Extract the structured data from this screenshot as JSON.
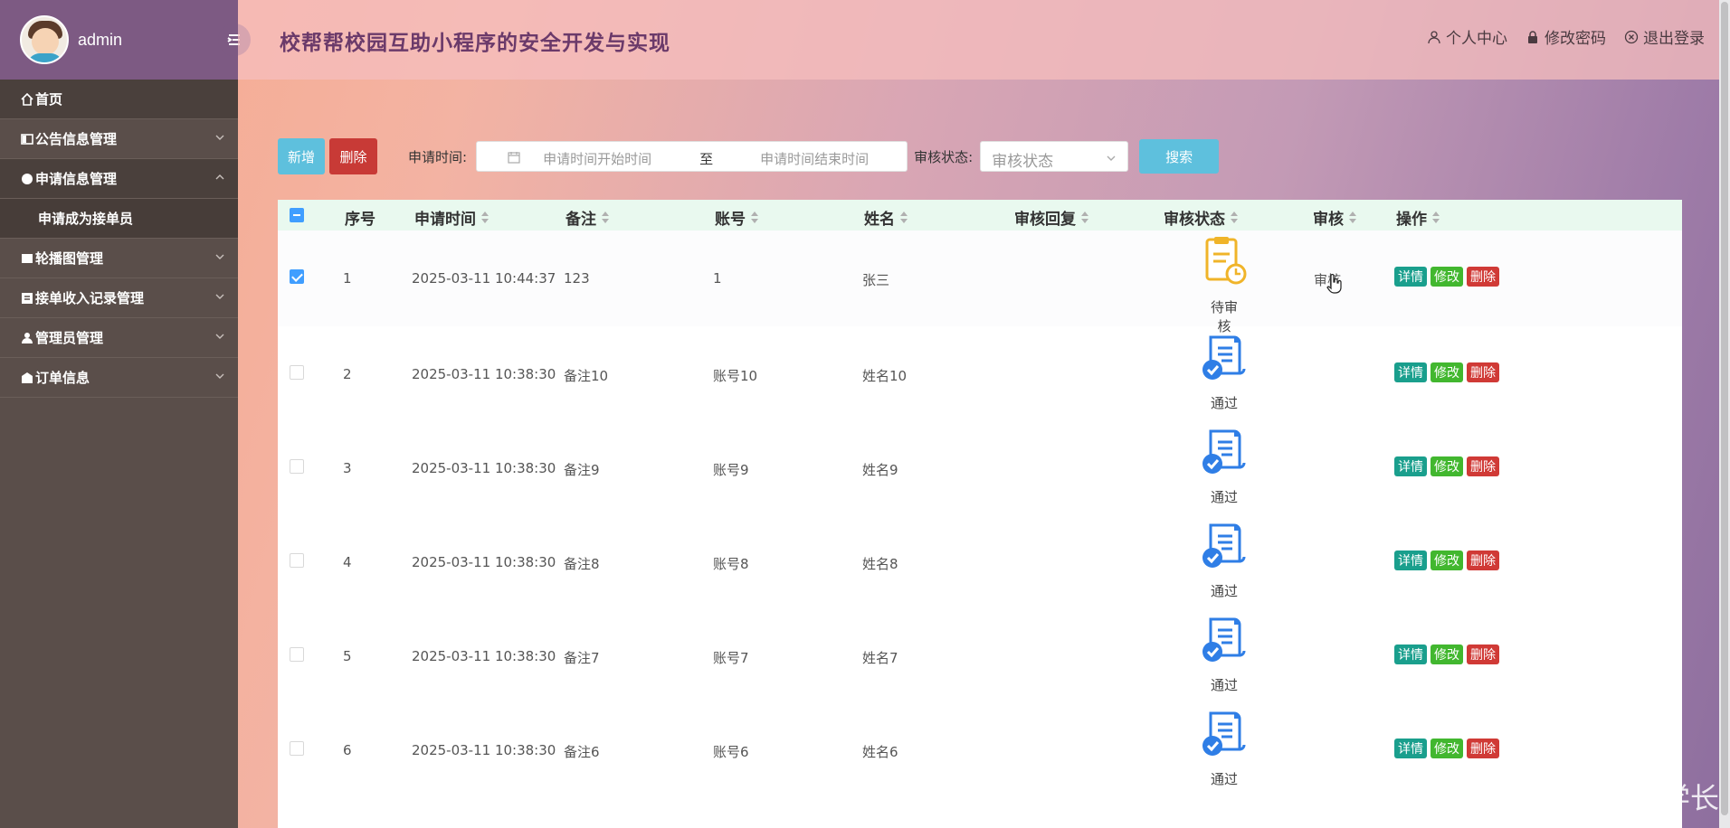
{
  "sidebar": {
    "username": "admin",
    "menu": [
      {
        "label": "首页",
        "icon": "home-icon"
      },
      {
        "label": "公告信息管理",
        "icon": "notice-icon"
      },
      {
        "label": "申请信息管理",
        "icon": "apply-icon",
        "expanded": true
      },
      {
        "label": "申请成为接单员",
        "sub": true
      },
      {
        "label": "轮播图管理",
        "icon": "image-icon"
      },
      {
        "label": "接单收入记录管理",
        "icon": "income-icon"
      },
      {
        "label": "管理员管理",
        "icon": "user-icon"
      },
      {
        "label": "订单信息",
        "icon": "order-icon"
      }
    ]
  },
  "header": {
    "title": "校帮帮校园互助小程序的安全开发与实现",
    "profile": "个人中心",
    "password": "修改密码",
    "logout": "退出登录"
  },
  "toolbar": {
    "add": "新增",
    "delete": "删除",
    "time_label": "申请时间:",
    "start_placeholder": "申请时间开始时间",
    "range_sep": "至",
    "end_placeholder": "申请时间结束时间",
    "status_label": "审核状态:",
    "status_placeholder": "审核状态",
    "search": "搜索"
  },
  "table": {
    "columns": [
      "序号",
      "申请时间",
      "备注",
      "账号",
      "姓名",
      "审核回复",
      "审核状态",
      "审核",
      "操作"
    ],
    "actions": {
      "detail": "详情",
      "edit": "修改",
      "delete": "删除"
    },
    "audit_label": "审核",
    "rows": [
      {
        "no": "1",
        "time": "2025-03-11 10:44:37",
        "remark": "123",
        "account": "1",
        "name": "张三",
        "reply": "",
        "status": "待审核",
        "status_icon": "pending-doc-icon",
        "checked": true
      },
      {
        "no": "2",
        "time": "2025-03-11 10:38:30",
        "remark": "备注10",
        "account": "账号10",
        "name": "姓名10",
        "reply": "",
        "status": "通过",
        "status_icon": "approved-doc-icon"
      },
      {
        "no": "3",
        "time": "2025-03-11 10:38:30",
        "remark": "备注9",
        "account": "账号9",
        "name": "姓名9",
        "reply": "",
        "status": "通过",
        "status_icon": "approved-doc-icon"
      },
      {
        "no": "4",
        "time": "2025-03-11 10:38:30",
        "remark": "备注8",
        "account": "账号8",
        "name": "姓名8",
        "reply": "",
        "status": "通过",
        "status_icon": "approved-doc-icon"
      },
      {
        "no": "5",
        "time": "2025-03-11 10:38:30",
        "remark": "备注7",
        "account": "账号7",
        "name": "姓名7",
        "reply": "",
        "status": "通过",
        "status_icon": "approved-doc-icon"
      },
      {
        "no": "6",
        "time": "2025-03-11 10:38:30",
        "remark": "备注6",
        "account": "账号6",
        "name": "姓名6",
        "reply": "",
        "status": "通过",
        "status_icon": "approved-doc-icon"
      }
    ]
  },
  "watermark": "CSDN @计算机程序猿学长",
  "colors": {
    "sidebar": "#5a4e4a",
    "sidebar_head": "#7d5a83",
    "accent_blue": "#5ec0dd",
    "danger": "#c83a36",
    "table_head": "#e9f9ef",
    "pending": "#f0b429",
    "approved": "#2f7ee6"
  }
}
